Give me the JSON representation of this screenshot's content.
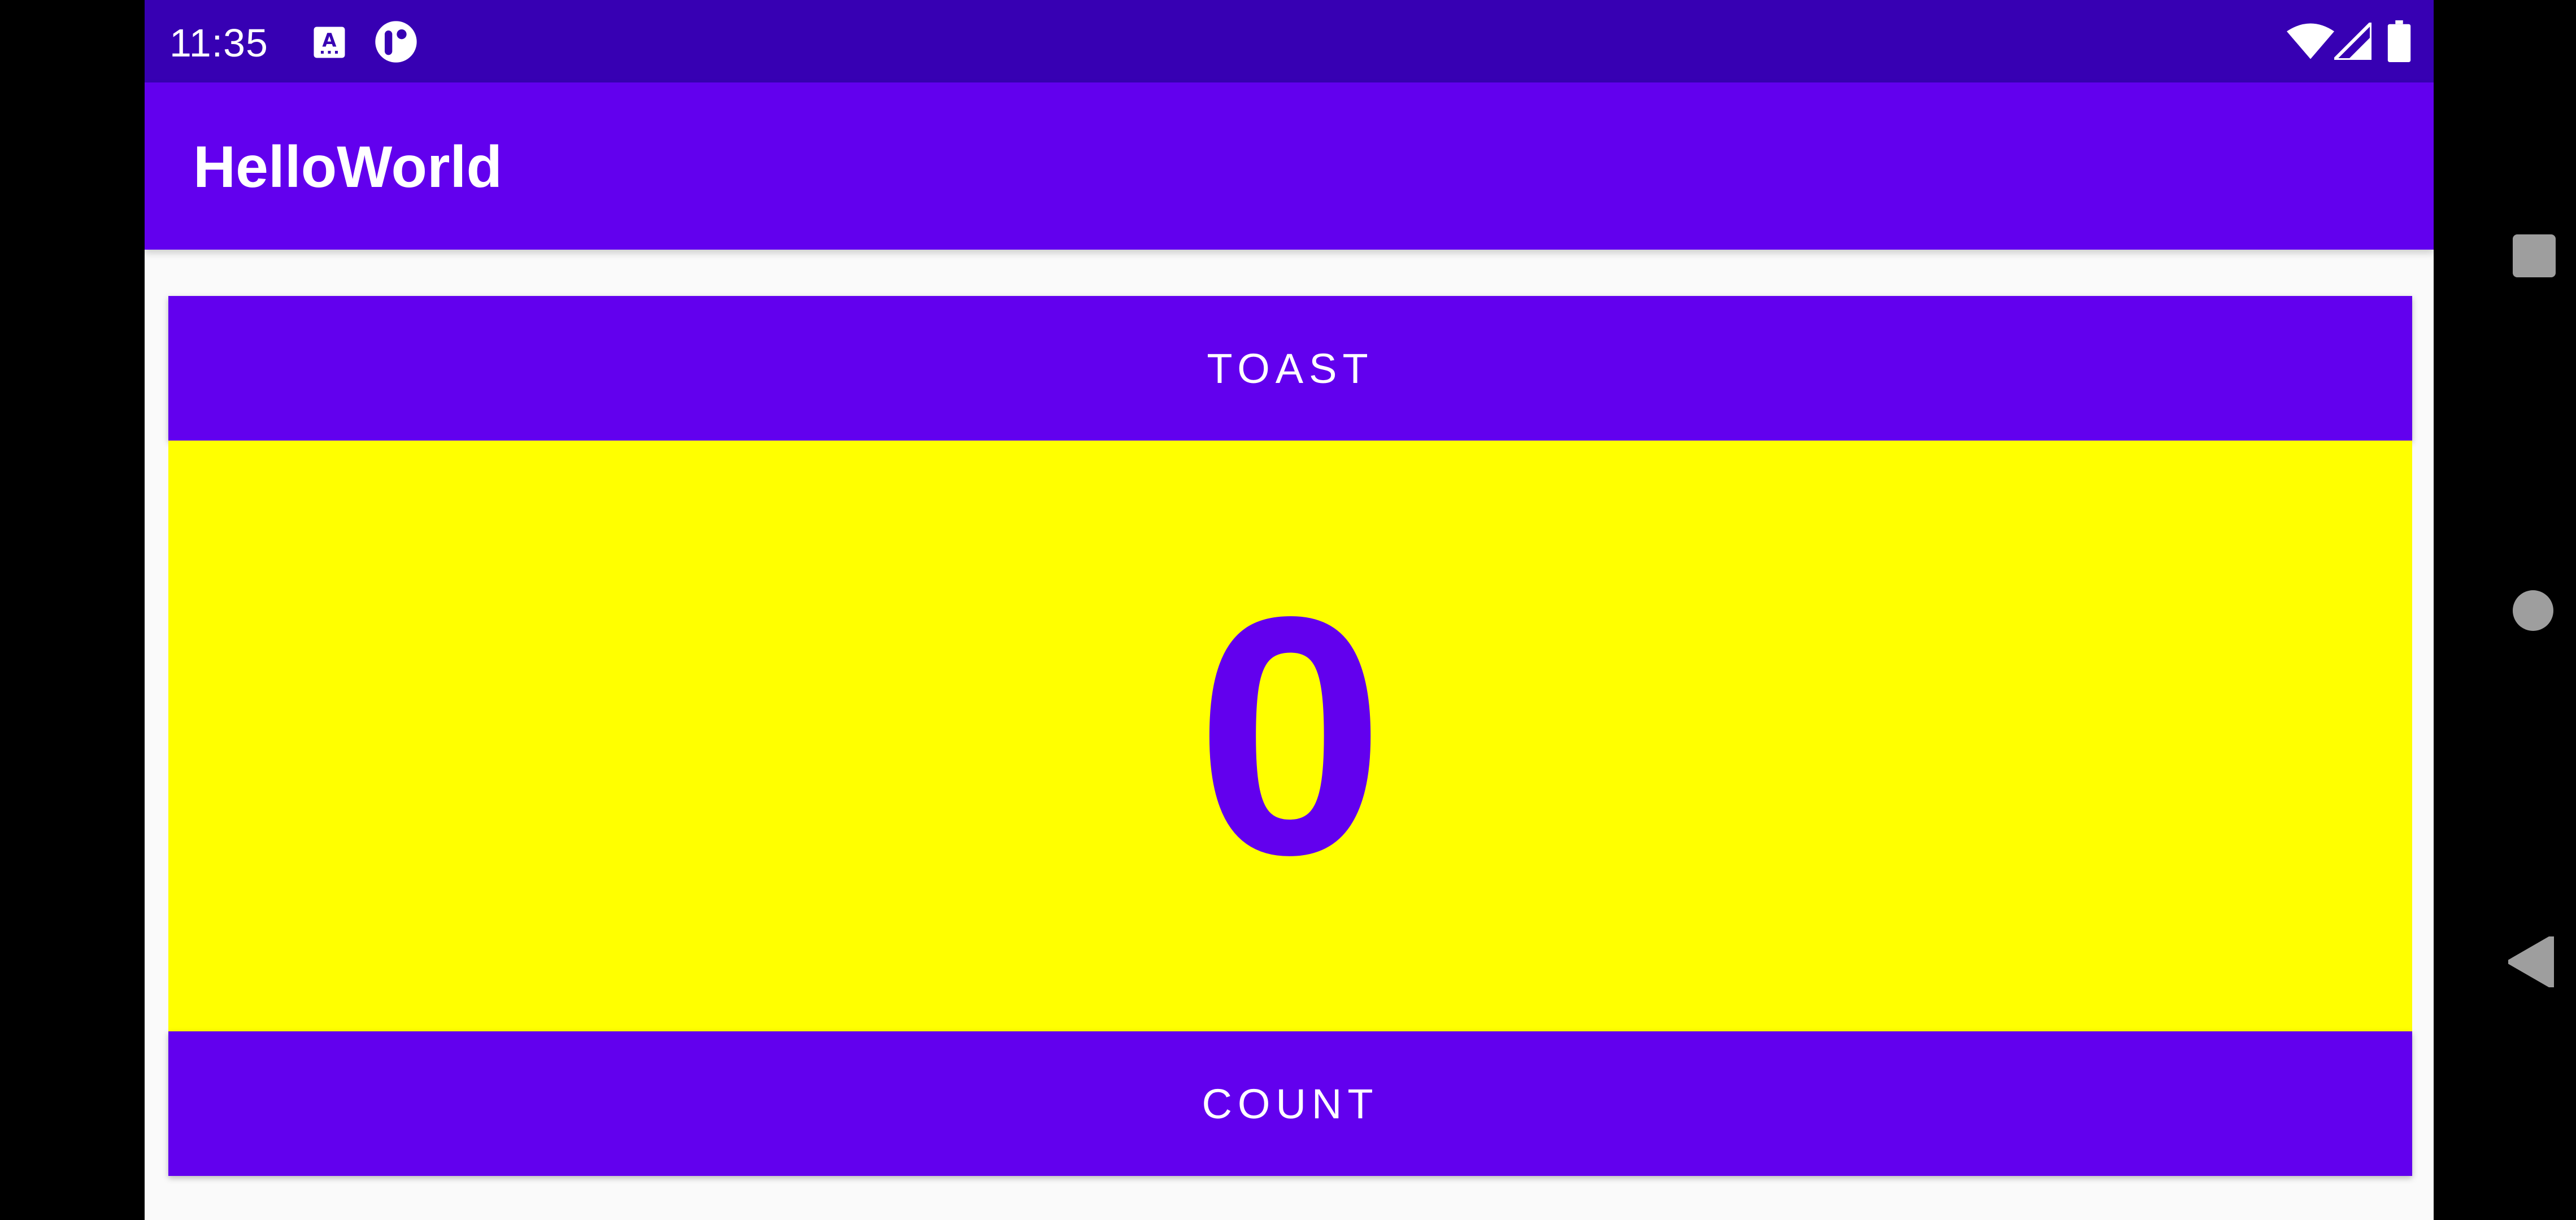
{
  "status_bar": {
    "time": "11:35",
    "icons": [
      "keyboard-a-icon",
      "sync-icon",
      "wifi-icon",
      "cell-signal-icon",
      "battery-icon"
    ],
    "background": "#3700b3"
  },
  "app_bar": {
    "title": "HelloWorld",
    "background": "#6200ee"
  },
  "main": {
    "toast_button_label": "TOAST",
    "count_value": "0",
    "count_button_label": "COUNT",
    "count_panel_color": "#ffff00",
    "accent": "#6200ee"
  },
  "nav_bar": {
    "items": [
      "recents-icon",
      "home-icon",
      "back-icon"
    ]
  }
}
